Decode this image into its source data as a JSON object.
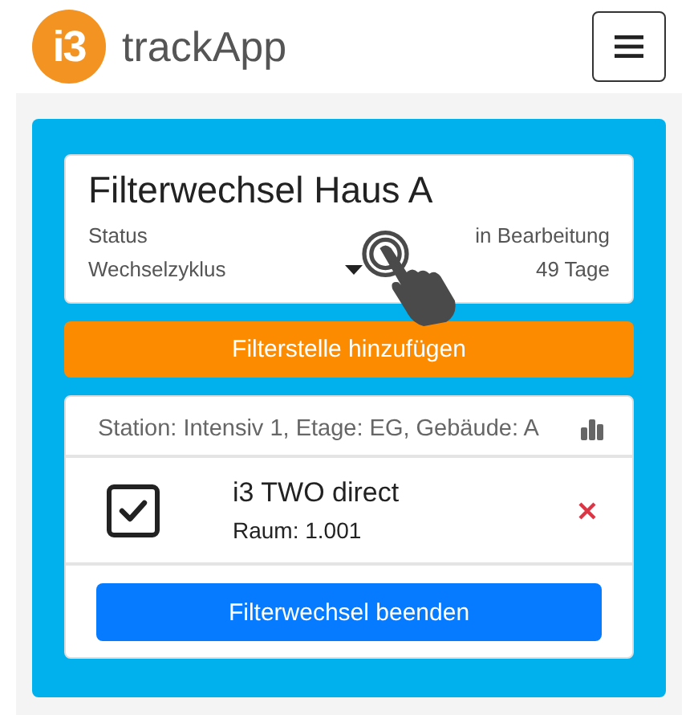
{
  "app": {
    "logo": "i3",
    "title": "trackApp"
  },
  "task": {
    "title": "Filterwechsel Haus A",
    "fields": [
      {
        "label": "Status",
        "value": "in Bearbeitung",
        "kind": "plain"
      },
      {
        "label": "Wechselzyklus",
        "value": "49 Tage",
        "kind": "dropdown"
      }
    ]
  },
  "add_button": "Filterstelle hinzufügen",
  "station": {
    "header": "Station: Intensiv 1, Etage: EG, Gebäude: A",
    "items": [
      {
        "name": "i3 TWO direct",
        "room": "Raum: 1.001",
        "checked": true
      }
    ],
    "finish_button": "Filterwechsel beenden"
  }
}
